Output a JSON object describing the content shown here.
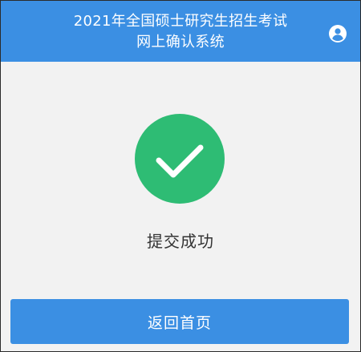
{
  "header": {
    "title_line1": "2021年全国硕士研究生招生考试",
    "title_line2": "网上确认系统",
    "user_icon": "user-circle-icon",
    "background_color": "#3b8fe3"
  },
  "result": {
    "icon": "check-circle-icon",
    "icon_color": "#2ebc74",
    "message": "提交成功"
  },
  "actions": {
    "home_label": "返回首页",
    "button_color": "#3b8fe3"
  }
}
